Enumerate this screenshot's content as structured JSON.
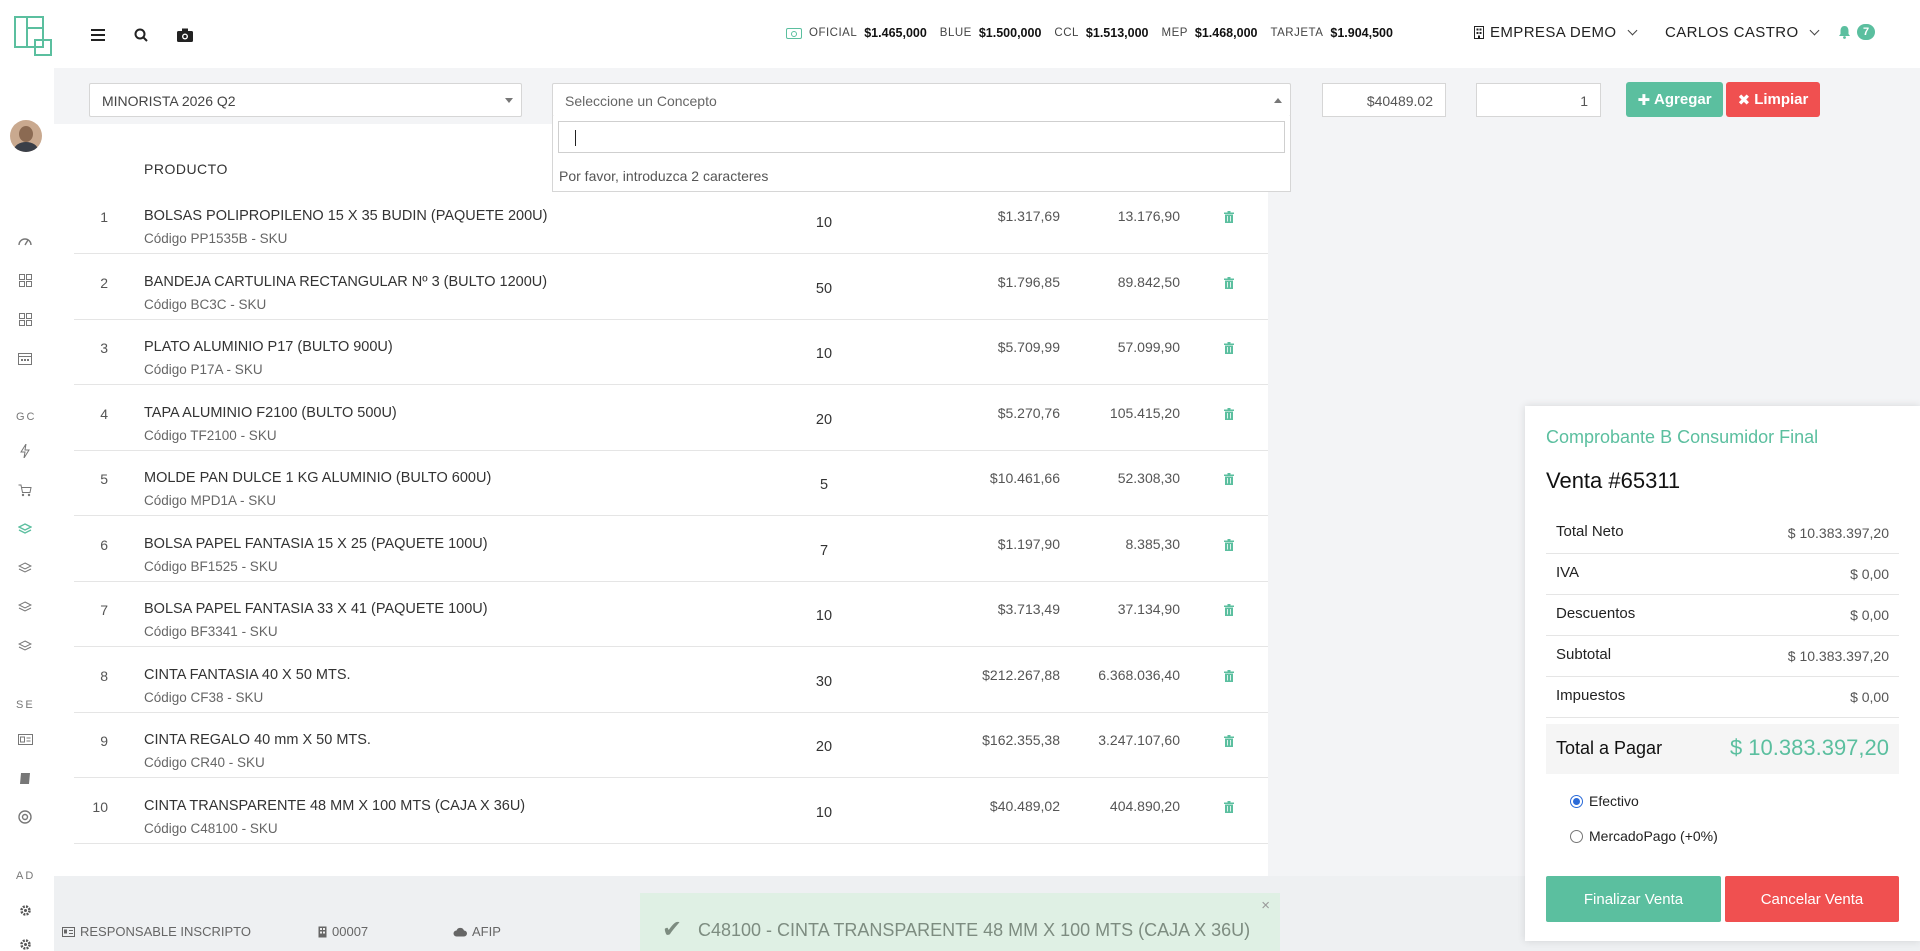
{
  "header": {
    "rates": [
      {
        "name": "OFICIAL",
        "value": "$1.465,000"
      },
      {
        "name": "BLUE",
        "value": "$1.500,000"
      },
      {
        "name": "CCL",
        "value": "$1.513,000"
      },
      {
        "name": "MEP",
        "value": "$1.468,000"
      },
      {
        "name": "TARJETA",
        "value": "$1.904,500"
      }
    ],
    "company": "EMPRESA DEMO",
    "user": "CARLOS CASTRO",
    "notifications": "7"
  },
  "sidebar": {
    "sections": [
      "GC",
      "SE",
      "AD"
    ]
  },
  "form": {
    "price_list": "MINORISTA 2026 Q2",
    "concept_placeholder": "Seleccione un Concepto",
    "dropdown_message": "Por favor, introduzca 2 caracteres",
    "price": "$40489.02",
    "quantity": "1",
    "add_label": "Agregar",
    "clear_label": "Limpiar"
  },
  "table": {
    "header_product": "PRODUCTO",
    "rows": [
      {
        "n": "1",
        "name": "BOLSAS POLIPROPILENO 15 X 35 BUDIN (PAQUETE 200U)",
        "code": "Código PP1535B - SKU",
        "qty": "10",
        "price": "$1.317,69",
        "total": "13.176,90"
      },
      {
        "n": "2",
        "name": "BANDEJA CARTULINA RECTANGULAR Nº 3 (BULTO 1200U)",
        "code": "Código BC3C - SKU",
        "qty": "50",
        "price": "$1.796,85",
        "total": "89.842,50"
      },
      {
        "n": "3",
        "name": "PLATO ALUMINIO P17 (BULTO 900U)",
        "code": "Código P17A - SKU",
        "qty": "10",
        "price": "$5.709,99",
        "total": "57.099,90"
      },
      {
        "n": "4",
        "name": "TAPA ALUMINIO F2100 (BULTO 500U)",
        "code": "Código TF2100 - SKU",
        "qty": "20",
        "price": "$5.270,76",
        "total": "105.415,20"
      },
      {
        "n": "5",
        "name": "MOLDE PAN DULCE 1 KG ALUMINIO (BULTO 600U)",
        "code": "Código MPD1A - SKU",
        "qty": "5",
        "price": "$10.461,66",
        "total": "52.308,30"
      },
      {
        "n": "6",
        "name": "BOLSA PAPEL FANTASIA 15 X 25 (PAQUETE 100U)",
        "code": "Código BF1525 - SKU",
        "qty": "7",
        "price": "$1.197,90",
        "total": "8.385,30"
      },
      {
        "n": "7",
        "name": "BOLSA PAPEL FANTASIA 33 X 41 (PAQUETE 100U)",
        "code": "Código BF3341 - SKU",
        "qty": "10",
        "price": "$3.713,49",
        "total": "37.134,90"
      },
      {
        "n": "8",
        "name": "CINTA FANTASIA 40 X 50 MTS.",
        "code": "Código CF38 - SKU",
        "qty": "30",
        "price": "$212.267,88",
        "total": "6.368.036,40"
      },
      {
        "n": "9",
        "name": "CINTA REGALO 40 mm X 50 MTS.",
        "code": "Código CR40 - SKU",
        "qty": "20",
        "price": "$162.355,38",
        "total": "3.247.107,60"
      },
      {
        "n": "10",
        "name": "CINTA TRANSPARENTE 48 MM X 100 MTS (CAJA X 36U)",
        "code": "Código C48100 - SKU",
        "qty": "10",
        "price": "$40.489,02",
        "total": "404.890,20"
      }
    ]
  },
  "footer": {
    "tax_status": "RESPONSABLE INSCRIPTO",
    "point_of_sale": "00007",
    "provider": "AFIP"
  },
  "toast": {
    "message": "C48100 - CINTA TRANSPARENTE 48 MM X 100 MTS (CAJA X 36U)",
    "close": "×"
  },
  "summary": {
    "voucher_type": "Comprobante B Consumidor Final",
    "sale_title": "Venta #65311",
    "lines": [
      {
        "label": "Total Neto",
        "value": "$ 10.383.397,20"
      },
      {
        "label": "IVA",
        "value": "$ 0,00"
      },
      {
        "label": "Descuentos",
        "value": "$ 0,00"
      },
      {
        "label": "Subtotal",
        "value": "$ 10.383.397,20"
      },
      {
        "label": "Impuestos",
        "value": "$ 0,00"
      }
    ],
    "total_label": "Total a Pagar",
    "total_value": "$ 10.383.397,20",
    "payment_methods": [
      {
        "label": "Efectivo",
        "selected": true
      },
      {
        "label": "MercadoPago (+0%)",
        "selected": false
      }
    ],
    "finalize_label": "Finalizar Venta",
    "cancel_label": "Cancelar Venta"
  },
  "colors": {
    "accent": "#5bbf9f",
    "danger": "#f05050"
  }
}
